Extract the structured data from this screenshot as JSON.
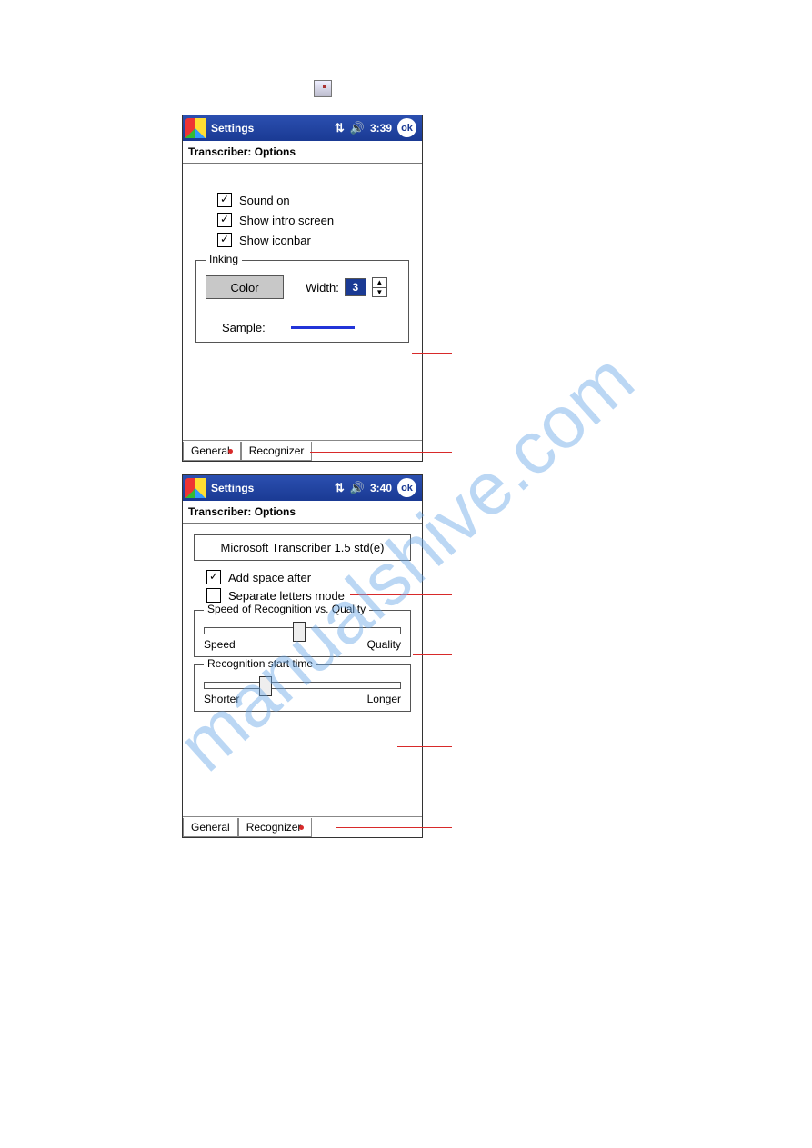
{
  "watermark": "manualshive.com",
  "top_icon_name": "options-toolbar-icon",
  "screenshot1": {
    "titlebar": {
      "title": "Settings",
      "clock": "3:39",
      "ok": "ok"
    },
    "subtitle": "Transcriber: Options",
    "checkboxes": [
      {
        "label": "Sound on",
        "checked": true
      },
      {
        "label": "Show intro screen",
        "checked": true
      },
      {
        "label": "Show iconbar",
        "checked": true
      }
    ],
    "inking": {
      "legend": "Inking",
      "color_btn": "Color",
      "width_label": "Width:",
      "width_value": "3",
      "sample_label": "Sample:"
    },
    "tabs": {
      "general": "General",
      "recognizer": "Recognizer",
      "active": "general"
    }
  },
  "screenshot2": {
    "titlebar": {
      "title": "Settings",
      "clock": "3:40",
      "ok": "ok"
    },
    "subtitle": "Transcriber: Options",
    "engine": "Microsoft Transcriber 1.5 std(e)",
    "checkboxes": [
      {
        "label": "Add space after",
        "checked": true
      },
      {
        "label": "Separate letters mode",
        "checked": false
      }
    ],
    "slider_speed": {
      "legend": "Speed of Recognition vs. Quality",
      "left": "Speed",
      "right": "Quality",
      "pos_pct": 45
    },
    "slider_start": {
      "legend": "Recognition start time",
      "left": "Shorter",
      "right": "Longer",
      "pos_pct": 28
    },
    "tabs": {
      "general": "General",
      "recognizer": "Recognizer",
      "active": "recognizer"
    }
  },
  "page_number": " "
}
